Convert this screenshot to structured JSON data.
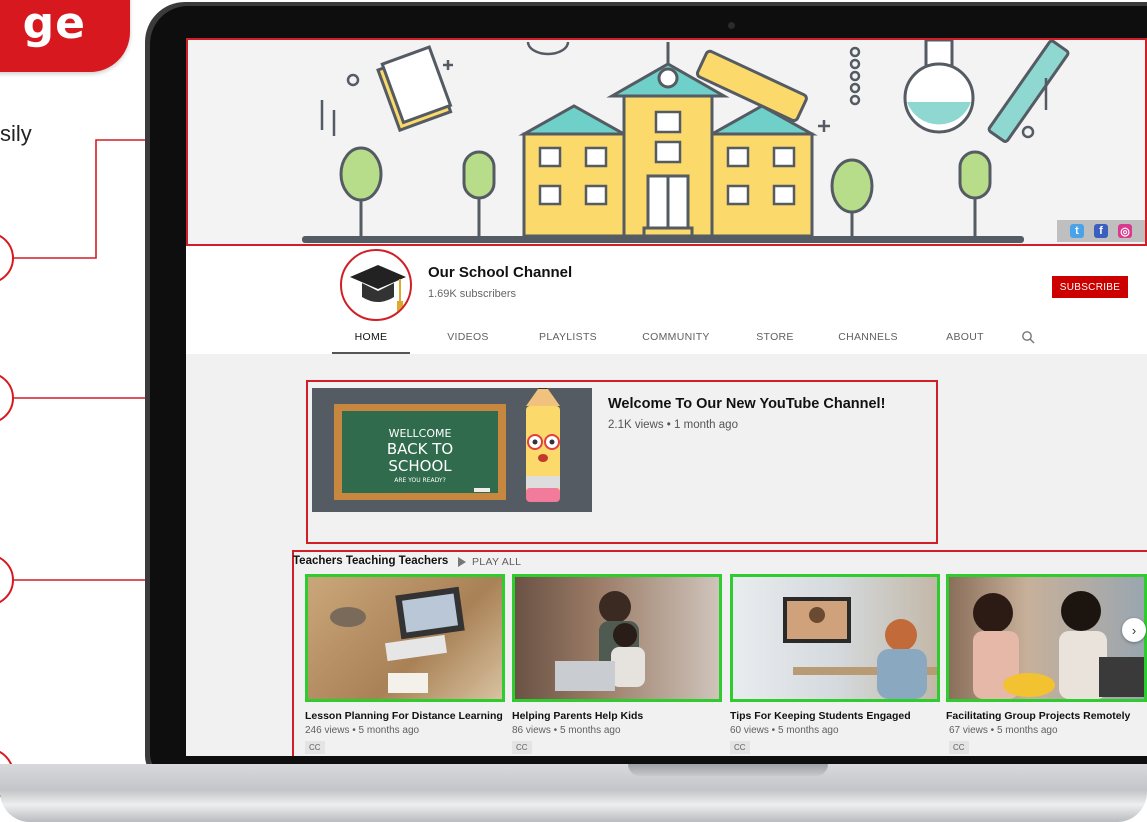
{
  "slide": {
    "heading_fragment": "ge",
    "text_fragment": "sily"
  },
  "banner": {
    "social_icons": [
      "twitter-icon",
      "facebook-icon",
      "instagram-icon"
    ],
    "social_glyphs": [
      "t",
      "f",
      "◎"
    ]
  },
  "channel": {
    "name": "Our School Channel",
    "subscribers": "1.69K subscribers",
    "subscribe_label": "SUBSCRIBE",
    "tabs": [
      "HOME",
      "VIDEOS",
      "PLAYLISTS",
      "COMMUNITY",
      "STORE",
      "CHANNELS",
      "ABOUT"
    ],
    "active_tab": "HOME"
  },
  "featured": {
    "title": "Welcome To Our New YouTube Channel!",
    "meta": "2.1K views • 1 month ago",
    "thumb_lines": [
      "WELLCOME",
      "BACK TO",
      "SCHOOL",
      "ARE YOU READY?"
    ]
  },
  "shelf": {
    "title": "Teachers Teaching Teachers",
    "play_all": "PLAY ALL",
    "videos": [
      {
        "title": "Lesson Planning For Distance Learning",
        "meta": "246 views • 5 months ago",
        "badge": "CC"
      },
      {
        "title": "Helping Parents Help Kids",
        "meta": "86 views • 5 months ago",
        "badge": "CC"
      },
      {
        "title": "Tips For Keeping Students Engaged",
        "meta": "60 views • 5 months ago",
        "badge": "CC"
      },
      {
        "title": "Facilitating Group Projects Remotely",
        "meta": "67 views • 5 months ago",
        "badge": "CC"
      }
    ],
    "next_glyph": "›"
  },
  "colors": {
    "accent_red": "#d01f26",
    "youtube_red": "#cc0000",
    "highlight_green": "#2ecc2e",
    "school_yellow": "#fbd96a",
    "roof_teal": "#6ed0c8"
  }
}
